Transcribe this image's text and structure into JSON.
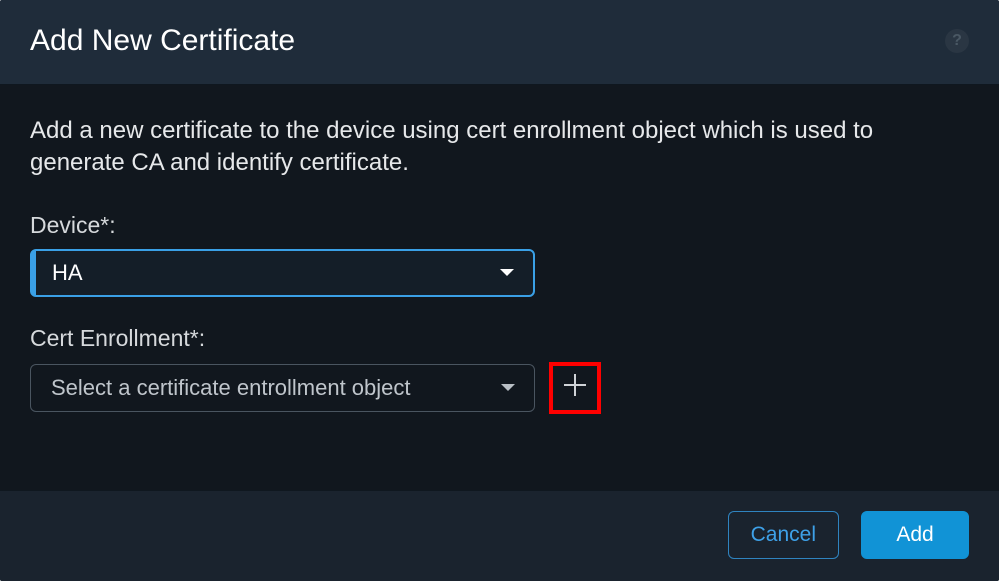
{
  "dialog": {
    "title": "Add New Certificate",
    "help_icon_label": "?",
    "description": "Add a new certificate to the device using cert enrollment object which is used to generate CA and identify certificate."
  },
  "device": {
    "label": "Device*:",
    "selected_value": "HA"
  },
  "cert_enrollment": {
    "label": "Cert Enrollment*:",
    "placeholder": "Select a certificate entrollment object"
  },
  "footer": {
    "cancel_label": "Cancel",
    "add_label": "Add"
  }
}
